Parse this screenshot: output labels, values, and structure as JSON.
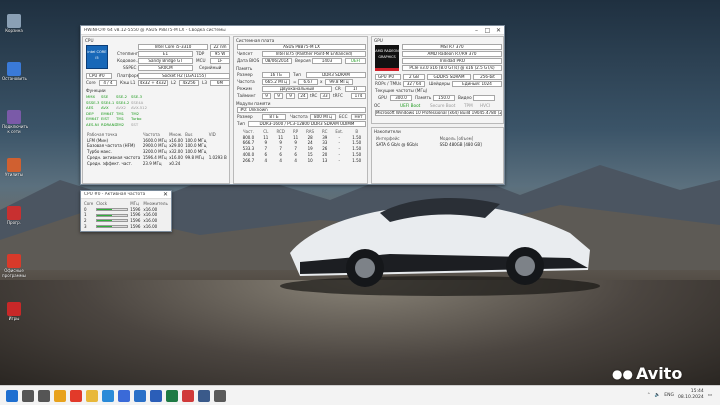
{
  "desktop_icons": [
    {
      "label": "Корзина",
      "icon": "recycle-bin-icon",
      "color": "#8aa0b5"
    },
    {
      "label": "Остановить",
      "icon": "stop-icon",
      "color": "#3a7ad8"
    },
    {
      "label": "Подключить к сети",
      "icon": "network-icon",
      "color": "#7a5aa8"
    },
    {
      "label": "Утилиты",
      "icon": "tools-icon",
      "color": "#d06030"
    },
    {
      "label": "Прогр.",
      "icon": "app-icon",
      "color": "#c83030"
    },
    {
      "label": "Офисные программы",
      "icon": "office-icon",
      "color": "#d83a2a"
    },
    {
      "label": "Игры",
      "icon": "games-icon",
      "color": "#c82828"
    }
  ],
  "hwinfo": {
    "title": "HWiNFO® 64 v8.12-5550 @ ASUS P8B75-M LX - Сводка системы",
    "cpu": {
      "section": "CPU",
      "logo": "intel CORE i5",
      "name": "Intel Core i5-3310",
      "nm": "22 nm",
      "stepping_label": "Степпинг",
      "stepping": "E1",
      "tdp_label": "TDP",
      "tdp": "95 W",
      "codename_label": "Кодовое...",
      "codename": "Sandy Bridge GT",
      "mcu_label": "MCU",
      "mcu": "1F",
      "sspec_label": "SSPEC",
      "sspec": "SR0CM",
      "serial_label": "Серийный",
      "selector": "CPU #0",
      "platform_label": "Платформа",
      "platform": "Socket H2 (LGA1155)",
      "cores_label": "Core",
      "cores": "4 / 4",
      "cache_label": "Кэш L1",
      "cache": "4x32 + 4x32",
      "l2_label": "L2",
      "l2": "4x256",
      "l3_label": "L3",
      "l3": "6M",
      "features_label": "Функции",
      "features": [
        [
          "MMX",
          "SSE",
          "SSE-2",
          "SSE-3"
        ],
        [
          "SSSE-3",
          "SSE4.1",
          "SSE4.2",
          "SSE4A"
        ],
        [
          "AES",
          "AVX",
          "AVX2",
          "AVX-512"
        ],
        [
          "DEP",
          "EM64T",
          "TM1",
          "TM2"
        ],
        [
          "EM64T",
          "EIST",
          "TM1",
          "Turbo"
        ],
        [
          "AES-NI",
          "RDRAND",
          "TM2",
          "SST"
        ]
      ],
      "op_headers": [
        "Рабочая точка",
        "Частота",
        "Множ.",
        "Bus",
        "VID"
      ],
      "op_rows": [
        [
          "LFM (Мин)",
          "1600.0 МГц",
          "x16.00",
          "100.0 МГц",
          ""
        ],
        [
          "Базовая частота (HFM)",
          "2900.0 МГц",
          "x29.00",
          "100.0 МГц",
          ""
        ],
        [
          "Турбо макс.",
          "3200.0 МГц",
          "x32.00",
          "100.0 МГц",
          ""
        ],
        [
          "Средн. активная частота",
          "1596.4 МГц",
          "x16.00",
          "99.8 МГц",
          "1.0293 В"
        ],
        [
          "Средн. эффект. част.",
          "23.9 МГц",
          "x0.24",
          "",
          ""
        ]
      ]
    },
    "mb": {
      "section": "Системная плата",
      "name": "ASUS P8B75-M LX",
      "chipset_label": "Чипсет",
      "chipset": "Intel B75 (Panther Point-M Enhanced)",
      "bios_label": "Дата BIOS",
      "bios_date": "08/06/2014",
      "version_label": "Версия",
      "version": "1403",
      "uefi": "UEFI",
      "mem_section": "Память",
      "size_label": "Размер",
      "size": "16 ГБ",
      "type_label": "Тип",
      "type": "DDR3 SDRAM",
      "freq_label": "Частота",
      "freq": "665.2 МГц",
      "eq": "=",
      "mult": "6.67",
      "x": "x",
      "bus": "99.8 МГц",
      "mode_label": "Режим",
      "mode": "Двухканальный",
      "cr_label": "CR",
      "cr": "1T",
      "timing_label": "Тайминг",
      "timings": [
        "9",
        "9",
        "9",
        "24"
      ],
      "trc_label": "tRC",
      "trc": "33",
      "trfc_label": "tRFC",
      "trfc": "174",
      "modules_label": "Модули памяти",
      "module_sel": "#0: Unknown",
      "msize_label": "Размер",
      "msize": "8 ГБ",
      "mfreq_label": "Частота",
      "mfreq": "800 МГц",
      "ecc_label": "ECC",
      "ecc": "Нет",
      "mtype_label": "Тип",
      "mtype": "DDR3-1600 / PC3-12800 DDR3 SDRAM UDIMM",
      "t_headers": [
        "Част.",
        "CL",
        "RCD",
        "RP",
        "RAS",
        "RC",
        "Ext.",
        "В"
      ],
      "t_rows": [
        [
          "800.0",
          "11",
          "11",
          "11",
          "28",
          "39",
          "-",
          "1.50"
        ],
        [
          "666.7",
          "9",
          "9",
          "9",
          "24",
          "33",
          "-",
          "1.50"
        ],
        [
          "533.3",
          "7",
          "7",
          "7",
          "19",
          "26",
          "-",
          "1.50"
        ],
        [
          "400.0",
          "6",
          "6",
          "6",
          "15",
          "20",
          "-",
          "1.50"
        ],
        [
          "266.7",
          "4",
          "4",
          "4",
          "10",
          "13",
          "-",
          "1.50"
        ]
      ]
    },
    "gpu": {
      "section": "GPU",
      "logo": "AMD RADEON GRAPHICS",
      "name": "MSI R7 370",
      "subname": "AMD Radeon R7/R9 370",
      "model": "Trinidad PRO",
      "pcie": "PCIe v3.0 x16 (8.0 GT/s) @ x16 (2.5 GT/s)",
      "selector": "GPU #0",
      "vram": "2 GB",
      "vram_type": "GDDR5 SDRAM",
      "bus": "256-bit",
      "rops_label": "ROPs / TMUs",
      "rops": "32 / 64",
      "shaders_label": "Шейдеры",
      "shaders": "Единый: 1024",
      "clocks_label": "Текущие частоты (МГц)",
      "gpu_clk_label": "GPU",
      "gpu_clk": "300.0",
      "mem_clk_label": "Память",
      "mem_clk": "150.0",
      "video_label": "Видео"
    },
    "os": {
      "section": "ОС",
      "uefi": "UEFI Boot",
      "secure": "Secure Boot",
      "tpm": "TPM",
      "hvci": "HVCI",
      "name": "Microsoft Windows 10 Professional (x64) Build 19045.4780 (22H2)"
    },
    "drives": {
      "section": "Накопители",
      "headers": [
        "Интерфейс",
        "Модель [объем]"
      ],
      "rows": [
        [
          "SATA 6 Gb/s @ 6Gb/s",
          "SSD 480GB [480 GB]"
        ]
      ]
    }
  },
  "cpu_window": {
    "title": "CPU #0 - Активная частота",
    "headers": [
      "Core",
      "Clock",
      "МГц",
      "Множитель"
    ],
    "rows": [
      [
        "0",
        "",
        "1596",
        "x16.00"
      ],
      [
        "1",
        "",
        "1596",
        "x16.00"
      ],
      [
        "2",
        "",
        "1596",
        "x16.00"
      ],
      [
        "3",
        "",
        "1596",
        "x16.00"
      ]
    ],
    "bar_fill": 0.5
  },
  "taskbar": {
    "apps": [
      {
        "icon": "start-icon",
        "color": "#1f6fd0"
      },
      {
        "icon": "search-icon",
        "color": "#555"
      },
      {
        "icon": "task-view-icon",
        "color": "#555"
      },
      {
        "icon": "chrome-icon",
        "color": "#e8a21d"
      },
      {
        "icon": "yandex-icon",
        "color": "#e23a2a"
      },
      {
        "icon": "explorer-icon",
        "color": "#e8b83a"
      },
      {
        "icon": "edge-icon",
        "color": "#2a8ad8"
      },
      {
        "icon": "store-icon",
        "color": "#3a6ad8"
      },
      {
        "icon": "mail-icon",
        "color": "#2a70c8"
      },
      {
        "icon": "word-icon",
        "color": "#2b5eb8"
      },
      {
        "icon": "excel-icon",
        "color": "#1e7a44"
      },
      {
        "icon": "media-icon",
        "color": "#d03a3a"
      },
      {
        "icon": "hwinfo-icon",
        "color": "#3a5a8a"
      },
      {
        "icon": "app-icon",
        "color": "#5a5a5a"
      }
    ],
    "lang": "ENG",
    "time": "15:44",
    "date": "08.10.2024"
  },
  "watermark": "Avito"
}
